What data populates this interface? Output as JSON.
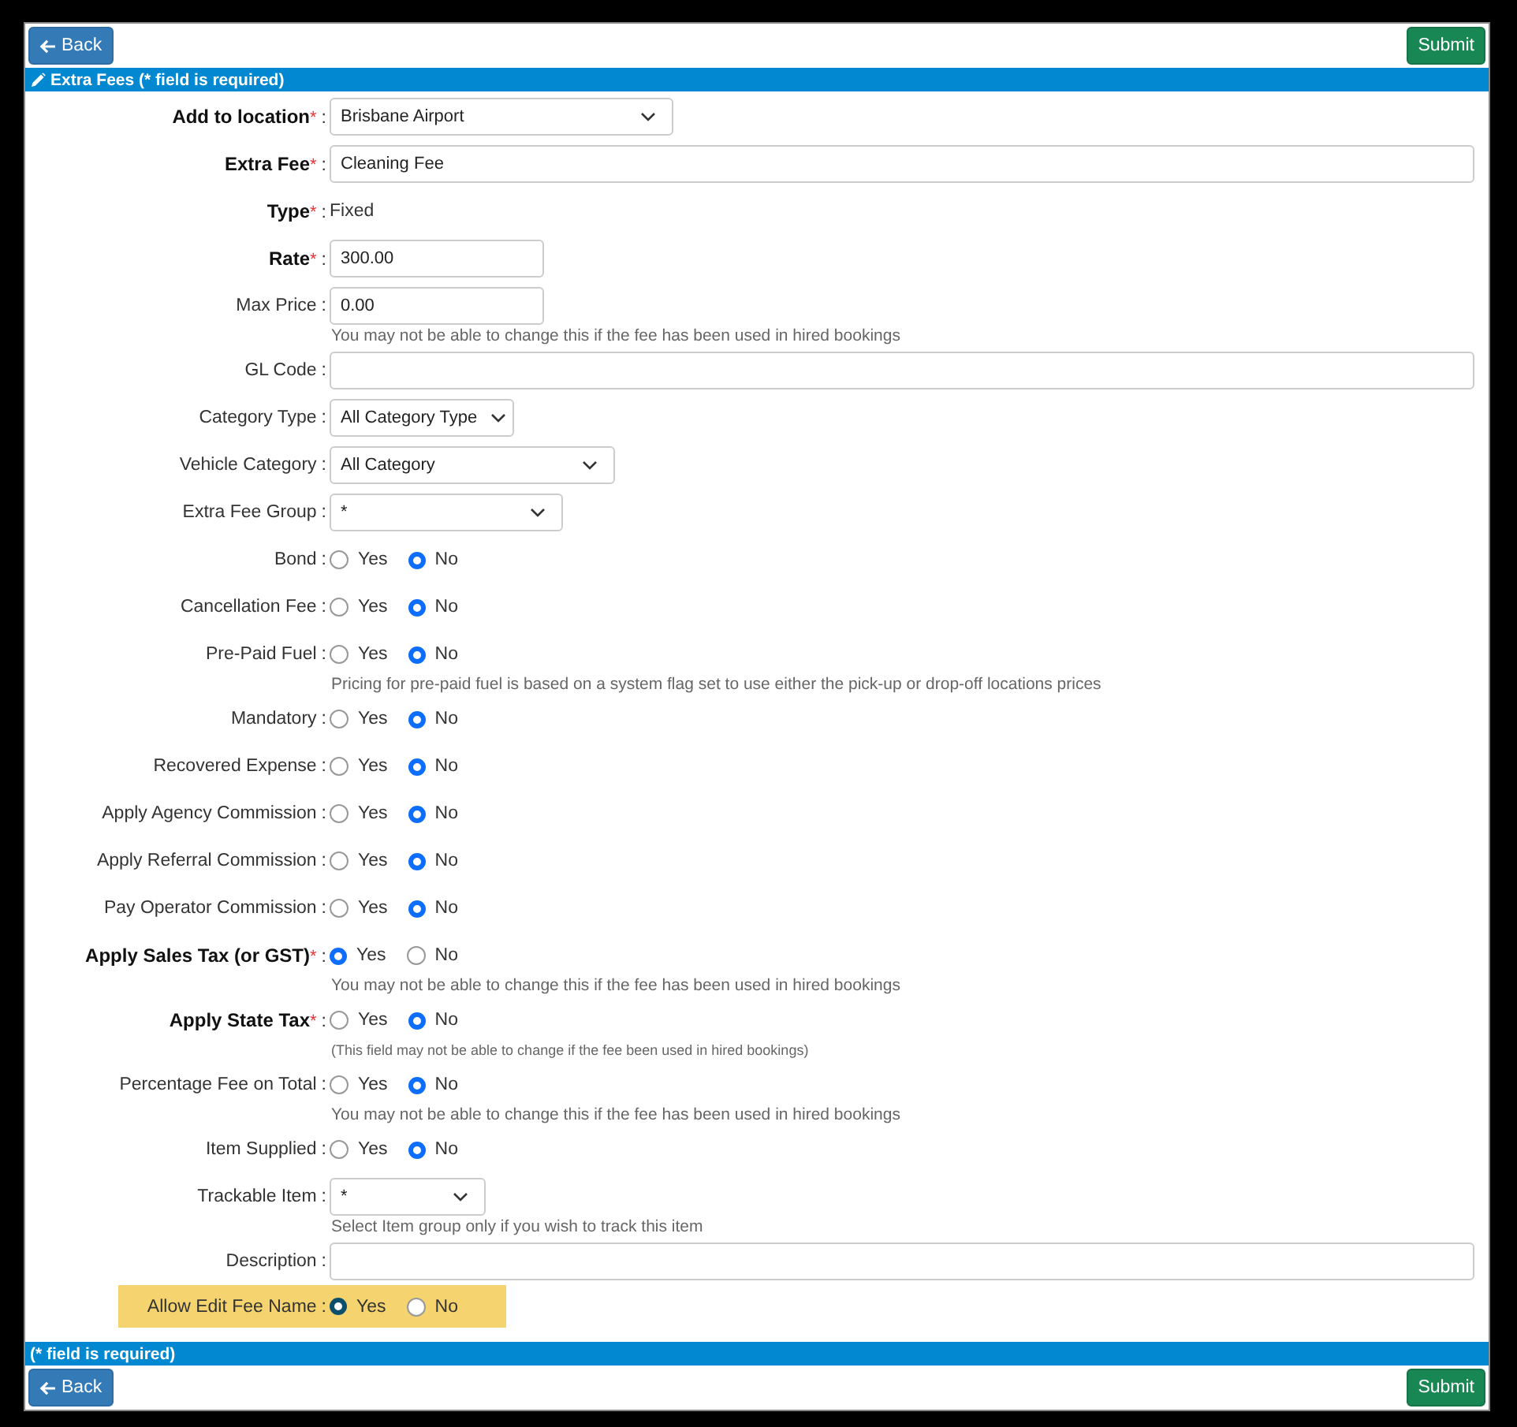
{
  "top_bar": {
    "back": "Back",
    "submit": "Submit"
  },
  "header": {
    "title": "Extra Fees (* field is required)"
  },
  "fields": [
    {
      "kind": "select",
      "label": "Add to location",
      "required": true,
      "required_mark": "*",
      "separator": ":",
      "value": "Brisbane Airport"
    },
    {
      "kind": "text",
      "label": "Extra Fee",
      "required": true,
      "required_mark": "*",
      "separator": ":",
      "value": "Cleaning Fee"
    },
    {
      "kind": "static",
      "label": "Type",
      "required": true,
      "required_mark": "*",
      "separator": ":",
      "value": "Fixed"
    },
    {
      "kind": "text",
      "label": "Rate",
      "required": true,
      "required_mark": "*",
      "separator": ":",
      "value": "300.00"
    },
    {
      "kind": "text",
      "label": "Max Price",
      "required": false,
      "separator": ":",
      "value": "0.00",
      "hint": "You may not be able to change this if the fee has been used in hired bookings"
    },
    {
      "kind": "text",
      "label": "GL Code",
      "required": false,
      "separator": ":"
    },
    {
      "kind": "select",
      "label": "Category Type",
      "required": false,
      "separator": ":",
      "value": "All Category Type"
    },
    {
      "kind": "select",
      "label": "Vehicle Category",
      "required": false,
      "separator": ":",
      "value": "All Category"
    },
    {
      "kind": "select",
      "label": "Extra Fee Group",
      "required": false,
      "separator": ":",
      "value": "*"
    },
    {
      "kind": "radio",
      "label": "Bond",
      "required": false,
      "separator": ":",
      "options": [
        {
          "label": "Yes",
          "selected": false
        },
        {
          "label": "No",
          "selected": true
        }
      ]
    },
    {
      "kind": "radio",
      "label": "Cancellation Fee",
      "required": false,
      "separator": ":",
      "options": [
        {
          "label": "Yes",
          "selected": false
        },
        {
          "label": "No",
          "selected": true
        }
      ]
    },
    {
      "kind": "radio",
      "label": "Pre-Paid Fuel",
      "required": false,
      "separator": ":",
      "options": [
        {
          "label": "Yes",
          "selected": false
        },
        {
          "label": "No",
          "selected": true
        }
      ],
      "hint": "Pricing for pre-paid fuel is based on a system flag set to use either the pick-up or drop-off locations prices"
    },
    {
      "kind": "radio",
      "label": "Mandatory",
      "required": false,
      "separator": ":",
      "options": [
        {
          "label": "Yes",
          "selected": false
        },
        {
          "label": "No",
          "selected": true
        }
      ]
    },
    {
      "kind": "radio",
      "label": "Recovered Expense",
      "required": false,
      "separator": ":",
      "options": [
        {
          "label": "Yes",
          "selected": false
        },
        {
          "label": "No",
          "selected": true
        }
      ]
    },
    {
      "kind": "radio",
      "label": "Apply Agency Commission",
      "required": false,
      "separator": ":",
      "options": [
        {
          "label": "Yes",
          "selected": false
        },
        {
          "label": "No",
          "selected": true
        }
      ]
    },
    {
      "kind": "radio",
      "label": "Apply Referral Commission",
      "required": false,
      "separator": ":",
      "options": [
        {
          "label": "Yes",
          "selected": false
        },
        {
          "label": "No",
          "selected": true
        }
      ]
    },
    {
      "kind": "radio",
      "label": "Pay Operator Commission",
      "required": false,
      "separator": ":",
      "options": [
        {
          "label": "Yes",
          "selected": false
        },
        {
          "label": "No",
          "selected": true
        }
      ]
    },
    {
      "kind": "radio",
      "label": "Apply Sales Tax (or GST)",
      "required": true,
      "required_mark": "*",
      "separator": ":",
      "options": [
        {
          "label": "Yes",
          "selected": true
        },
        {
          "label": "No",
          "selected": false
        }
      ],
      "hint": "You may not be able to change this if the fee has been used in hired bookings"
    },
    {
      "kind": "radio",
      "label": "Apply State Tax",
      "required": true,
      "required_mark": "*",
      "separator": ":",
      "options": [
        {
          "label": "Yes",
          "selected": false
        },
        {
          "label": "No",
          "selected": true
        }
      ],
      "hint": "(This field may not be able to change if the fee been used in hired bookings)",
      "fine_print": true
    },
    {
      "kind": "radio",
      "label": "Percentage Fee on Total",
      "required": false,
      "separator": ":",
      "options": [
        {
          "label": "Yes",
          "selected": false
        },
        {
          "label": "No",
          "selected": true
        }
      ],
      "hint": "You may not be able to change this if the fee has been used in hired bookings"
    },
    {
      "kind": "radio",
      "label": "Item Supplied",
      "required": false,
      "separator": ":",
      "options": [
        {
          "label": "Yes",
          "selected": false
        },
        {
          "label": "No",
          "selected": true
        }
      ]
    },
    {
      "kind": "select",
      "label": "Trackable Item",
      "required": false,
      "separator": ":",
      "value": "*",
      "hint": "Select Item group only if you wish to track this item"
    },
    {
      "kind": "text",
      "label": "Description",
      "required": false,
      "separator": ":"
    },
    {
      "kind": "radio",
      "label": "Allow Edit Fee Name",
      "required": false,
      "separator": ":",
      "highlighted": true,
      "options": [
        {
          "label": "Yes",
          "selected": true
        },
        {
          "label": "No",
          "selected": false
        }
      ]
    }
  ],
  "footer": {
    "note": "(* field is required)"
  },
  "bottom_bar": {
    "back": "Back",
    "submit": "Submit"
  }
}
